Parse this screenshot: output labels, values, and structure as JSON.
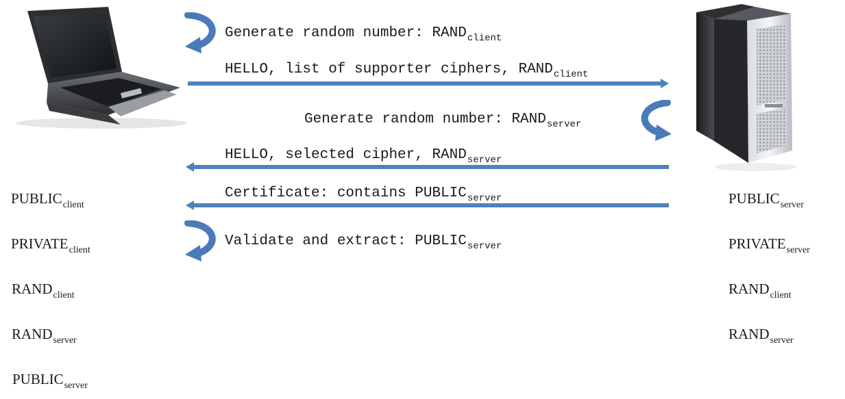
{
  "colors": {
    "arrow": "#4f81bd",
    "curl": "#4a7ab8"
  },
  "steps": [
    {
      "id": "gen-client",
      "text": "Generate random number:  RAND",
      "sub": "client"
    },
    {
      "id": "hello-client",
      "text": "HELLO, list of supporter ciphers, RAND",
      "sub": "client"
    },
    {
      "id": "gen-server",
      "text": "Generate random number:  RAND",
      "sub": "server"
    },
    {
      "id": "hello-server",
      "text": "HELLO, selected cipher, RAND",
      "sub": "server"
    },
    {
      "id": "certificate",
      "text": "Certificate: contains PUBLIC",
      "sub": "server"
    },
    {
      "id": "validate",
      "text": "Validate and extract:  PUBLIC",
      "sub": "server"
    }
  ],
  "client_keys": [
    {
      "text": "PUBLIC",
      "sub": "client"
    },
    {
      "text": "PRIVATE",
      "sub": "client"
    },
    {
      "text": "RAND",
      "sub": "client"
    },
    {
      "text": "RAND",
      "sub": "server"
    },
    {
      "text": "PUBLIC",
      "sub": "server"
    }
  ],
  "server_keys": [
    {
      "text": "PUBLIC",
      "sub": "server"
    },
    {
      "text": "PRIVATE",
      "sub": "server"
    },
    {
      "text": "RAND",
      "sub": "client"
    },
    {
      "text": "RAND",
      "sub": "server"
    }
  ],
  "icons": {
    "client": "laptop-icon",
    "server": "server-tower-icon",
    "self_step": "curved-arrow-icon"
  }
}
